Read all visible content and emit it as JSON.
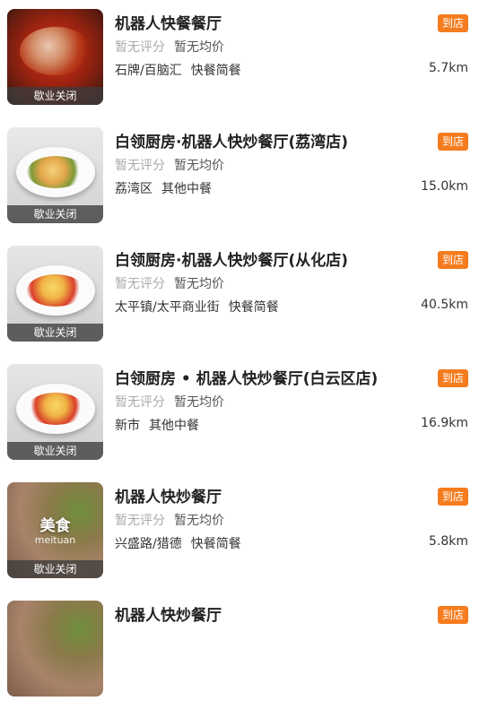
{
  "restaurants": [
    {
      "name": "机器人快餐餐厅",
      "status": "歇业关闭",
      "rating": "暂无评分",
      "avg_price": "暂无均价",
      "area": "石牌/百脑汇",
      "category": "快餐简餐",
      "distance": "5.7km",
      "badge": "到店",
      "thumb_icon": "spicy-dish-photo"
    },
    {
      "name": "白领厨房·机器人快炒餐厅(荔湾店)",
      "status": "歇业关闭",
      "rating": "暂无评分",
      "avg_price": "暂无均价",
      "area": "荔湾区",
      "category": "其他中餐",
      "distance": "15.0km",
      "badge": "到店",
      "thumb_icon": "stir-fry-dish-photo"
    },
    {
      "name": "白领厨房·机器人快炒餐厅(从化店)",
      "status": "歇业关闭",
      "rating": "暂无评分",
      "avg_price": "暂无均价",
      "area": "太平镇/太平商业街",
      "category": "快餐简餐",
      "distance": "40.5km",
      "badge": "到店",
      "thumb_icon": "tomato-egg-dish-photo"
    },
    {
      "name": "白领厨房 • 机器人快炒餐厅(白云区店)",
      "status": "歇业关闭",
      "rating": "暂无评分",
      "avg_price": "暂无均价",
      "area": "新市",
      "category": "其他中餐",
      "distance": "16.9km",
      "badge": "到店",
      "thumb_icon": "tomato-egg-dish-photo"
    },
    {
      "name": "机器人快炒餐厅",
      "status": "歇业关闭",
      "rating": "暂无评分",
      "avg_price": "暂无均价",
      "area": "兴盛路/猎德",
      "category": "快餐简餐",
      "distance": "5.8km",
      "badge": "到店",
      "thumb_icon": "meituan-placeholder",
      "thumb_text": "美食",
      "thumb_sub": "meituan"
    },
    {
      "name": "机器人快炒餐厅",
      "badge": "到店",
      "thumb_icon": "meituan-placeholder"
    }
  ],
  "colors": {
    "badge": "#f57c1f",
    "rating_gray": "#aaaaaa"
  }
}
